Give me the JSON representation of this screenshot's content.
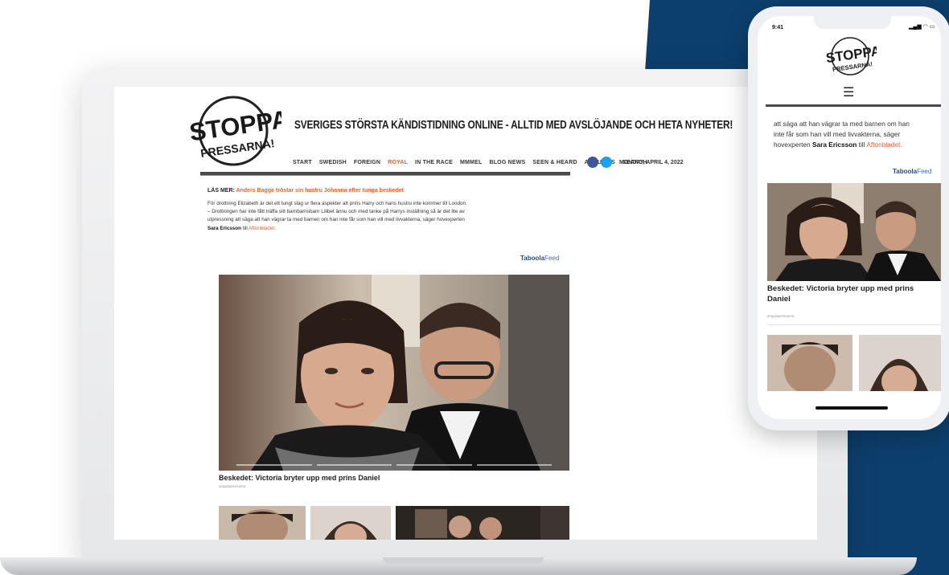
{
  "site": {
    "logo_line1": "STOPPA",
    "logo_line2": "PRESSARNA!",
    "headline": "SVERIGES STÖRSTA KÄNDISTIDNING ONLINE - ALLTID MED AVSLÖJANDE OCH HETA NYHETER!",
    "nav": [
      "START",
      "SWEDISH",
      "FOREIGN",
      "ROYAL",
      "IN THE RACE",
      "MMMEL",
      "BLOG NEWS",
      "SEEN & HEARD",
      "ABOUT US",
      "SEARCH"
    ],
    "active_nav": "ROYAL",
    "date": "MONDAY, APRIL 4, 2022",
    "colors": {
      "accent": "#e8632b",
      "navy": "#0d3f6e",
      "facebook": "#3b5998",
      "twitter": "#1da1f2"
    }
  },
  "article": {
    "readmore_label": "LÄS MER:",
    "readmore_link": "Anders Bagge tröstar sin hustru Johanna efter tunga beskedet",
    "para_line1": "För drottning Elizabeth är det ett tungt slag ur flera aspekter att prins Harry och hans hustru inte kommer till London.",
    "para_line2": "– Drottningen har inte fått träffa sitt barnbarnsbarn Lilibet ännu och med tanke på Harrys inställning så är det lite av",
    "para_line3": "utpressning att säga att han vägrar ta med barnen om han inte får som han vill med livvakterna, säger hovexperten",
    "expert": "Sara Ericsson",
    "till": "till",
    "source": "Aftonbladet."
  },
  "taboola": {
    "brand": "Taboola",
    "feed": "Feed"
  },
  "feed": {
    "main_caption": "Beskedet: Victoria bryter upp med prins Daniel",
    "main_source": "stoppapressarna"
  },
  "phone": {
    "time": "9:41",
    "status": "▂▄▆ ◠ ▭",
    "menu_icon": "☰",
    "text_line1": "att säga att han vägrar ta med barnen om han",
    "text_line2": "inte får som han vill med livvakterna, säger",
    "text_line3": "hovexperten",
    "expert": "Sara Ericsson",
    "till": "till",
    "source": "Aftonbladet.",
    "caption": "Beskedet: Victoria bryter upp med prins Daniel",
    "caption_source": "stoppapressarna"
  }
}
